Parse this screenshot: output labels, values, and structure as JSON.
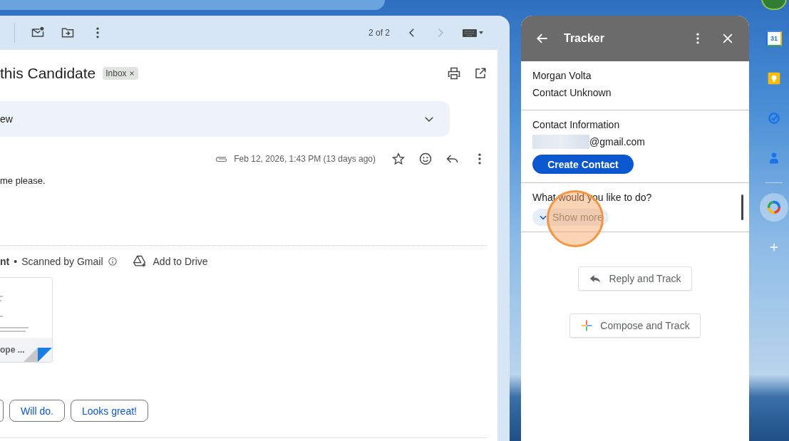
{
  "toolbar": {
    "pager": "2 of 2",
    "nav": [
      {
        "kind": "prev",
        "disabled": false
      },
      {
        "kind": "next",
        "disabled": true
      }
    ]
  },
  "email": {
    "subject": "this Candidate",
    "label": "Inbox",
    "collapsed_message": "ew",
    "timestamp": "Feb 12, 2026, 1:43 PM (13 days ago)",
    "starred": false,
    "body": "me please.",
    "attachment": {
      "heading": "nt",
      "separator": "•",
      "scan": "Scanned by Gmail",
      "drive": "Add to Drive",
      "file_name": "ope ..."
    },
    "smart_replies": [
      "Will do.",
      "Looks great!"
    ]
  },
  "tracker": {
    "title": "Tracker",
    "contact_name": "Morgan Volta",
    "contact_status": "Contact Unknown",
    "info_heading": "Contact Information",
    "email_suffix": "@gmail.com",
    "create_button": "Create Contact",
    "question": "What would you like to do?",
    "show_more": {
      "label": "Show more",
      "expanded": false
    },
    "actions": [
      {
        "kind": "reply",
        "label": "Reply and Track"
      },
      {
        "kind": "compose",
        "label": "Compose and Track"
      }
    ]
  },
  "side_apps": [
    {
      "kind": "calendar",
      "label": "31",
      "selected": false
    },
    {
      "kind": "keep",
      "selected": false
    },
    {
      "kind": "tasks",
      "selected": false
    },
    {
      "kind": "contacts",
      "selected": false
    },
    {
      "kind": "tracker",
      "selected": true
    },
    {
      "kind": "add",
      "selected": false
    }
  ]
}
